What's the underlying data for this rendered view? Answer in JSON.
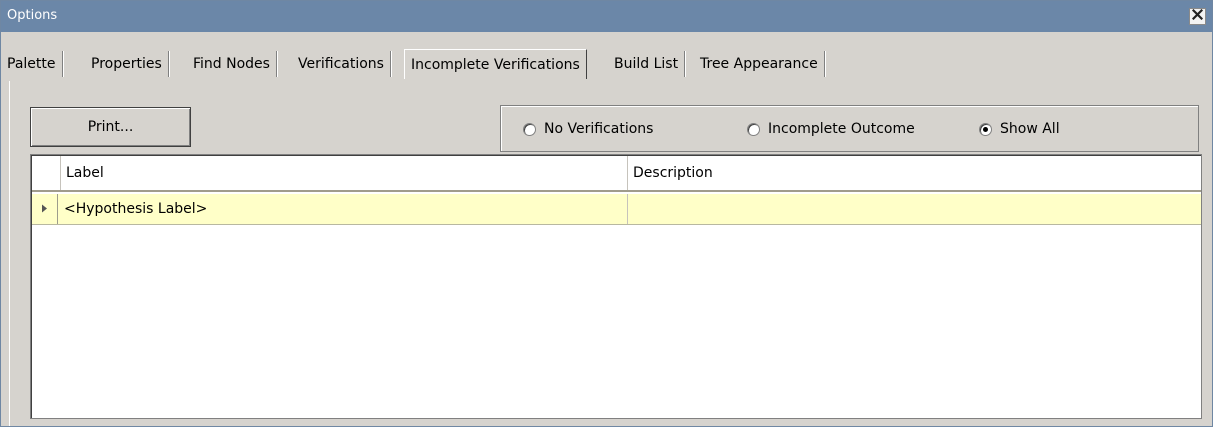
{
  "window": {
    "title": "Options",
    "titlebar_color": "#6b87a8"
  },
  "titlebar": {
    "close_icon": "close-icon"
  },
  "tabs": [
    {
      "label": "Palette",
      "active": false
    },
    {
      "label": "Properties",
      "active": false
    },
    {
      "label": "Find Nodes",
      "active": false
    },
    {
      "label": "Verifications",
      "active": false
    },
    {
      "label": "Incomplete Verifications",
      "active": true
    },
    {
      "label": "Build List",
      "active": false
    },
    {
      "label": "Tree Appearance",
      "active": false
    }
  ],
  "panel": {
    "print_label": "Print...",
    "filter": {
      "options": [
        {
          "label": "No Verifications",
          "checked": false
        },
        {
          "label": "Incomplete Outcome",
          "checked": false
        },
        {
          "label": "Show All",
          "checked": true
        }
      ]
    },
    "grid": {
      "columns": [
        "Label",
        "Description"
      ],
      "rows": [
        {
          "label": "<Hypothesis Label>",
          "description": ""
        }
      ],
      "row_highlight_color": "#ffffc8",
      "row_indicator_icon": "triangle-right-icon"
    }
  }
}
